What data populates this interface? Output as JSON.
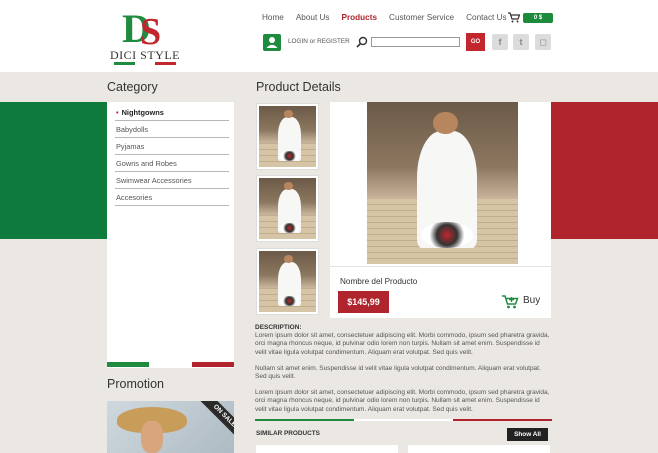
{
  "brand": {
    "name": "DICI STYLE",
    "monogram": "DS"
  },
  "nav": {
    "items": [
      {
        "label": "Home",
        "active": false
      },
      {
        "label": "About Us",
        "active": false
      },
      {
        "label": "Products",
        "active": true
      },
      {
        "label": "Customer Service",
        "active": false
      },
      {
        "label": "Contact Us",
        "active": false
      }
    ],
    "cart_total": "0 $"
  },
  "account": {
    "login_label": "LOGIN or REGISTER"
  },
  "search": {
    "button_label": "GO",
    "value": ""
  },
  "social": [
    {
      "icon": "facebook-icon",
      "glyph": "f"
    },
    {
      "icon": "twitter-icon",
      "glyph": "t"
    },
    {
      "icon": "instagram-icon",
      "glyph": "◻"
    }
  ],
  "sidebar": {
    "category_title": "Category",
    "categories": [
      {
        "label": "Nightgowns",
        "selected": true
      },
      {
        "label": "Babydolls",
        "selected": false
      },
      {
        "label": "Pyjamas",
        "selected": false
      },
      {
        "label": "Gowns and Robes",
        "selected": false
      },
      {
        "label": "Swimwear Accessories",
        "selected": false
      },
      {
        "label": "Accesories",
        "selected": false
      }
    ],
    "promotion_title": "Promotion",
    "promo_badge": "ON SALE!"
  },
  "product": {
    "section_title": "Product Details",
    "name": "Nombre del Producto",
    "price": "$145,99",
    "buy_label": "Buy",
    "description_title": "DESCRIPTION:",
    "description": [
      "Lorem ipsum dolor sit amet, consectetuer adipiscing elit. Morbi commodo, ipsum sed pharetra gravida, orci magna rhoncus neque, id pulvinar odio lorem non turpis. Nullam sit amet enim. Suspendisse id velit vitae ligula volutpat condimentum. Aliquam erat volutpat. Sed quis velit.",
      "Nullam sit amet enim. Suspendisse id velit vitae ligula volutpat condimentum. Aliquam erat volutpat. Sed quis velit.",
      "Lorem ipsum dolor sit amet, consectetuer adipiscing elit. Morbi commodo, ipsum sed pharetra gravida, orci magna rhoncus neque, id pulvinar odio lorem non turpis. Nullam sit amet enim. Suspendisse id velit vitae ligula volutpat condimentum. Aliquam erat volutpat. Sed quis velit."
    ]
  },
  "similar": {
    "title": "SIMILAR PRODUCTS",
    "show_all_label": "Show All"
  },
  "colors": {
    "green": "#0e7b3c",
    "red": "#b0242d",
    "background": "#ebe8e3"
  }
}
